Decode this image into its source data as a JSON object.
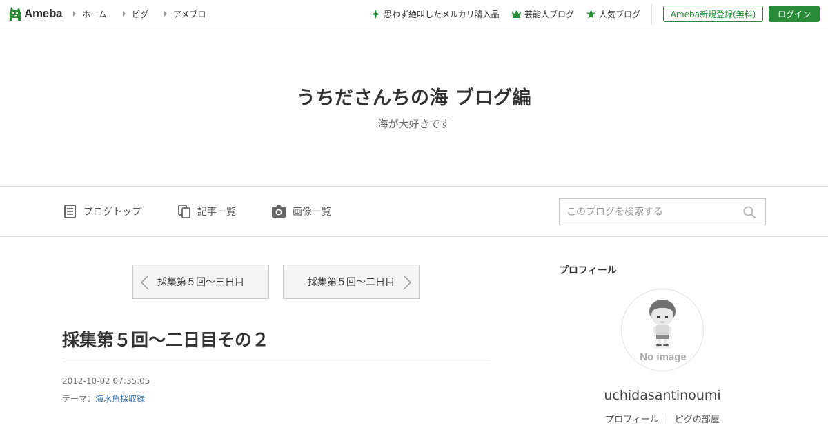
{
  "topbar": {
    "logo_text": "Ameba",
    "nav": [
      "ホーム",
      "ピグ",
      "アメブロ"
    ],
    "right_links": [
      {
        "label": "思わず絶叫したメルカリ購入品",
        "icon": "sparkle-icon"
      },
      {
        "label": "芸能人ブログ",
        "icon": "crown-icon"
      },
      {
        "label": "人気ブログ",
        "icon": "star-icon"
      }
    ],
    "register_label": "Ameba新規登録(無料)",
    "login_label": "ログイン"
  },
  "header": {
    "title": "うちださんちの海 ブログ編",
    "description": "海が大好きです"
  },
  "global_nav": [
    {
      "label": "ブログトップ",
      "icon": "document-icon"
    },
    {
      "label": "記事一覧",
      "icon": "copy-icon"
    },
    {
      "label": "画像一覧",
      "icon": "camera-icon"
    }
  ],
  "search": {
    "placeholder": "このブログを検索する"
  },
  "pager": {
    "prev_label": "採集第５回～三日目",
    "next_label": "採集第５回～二日目"
  },
  "article": {
    "title": "採集第５回～二日目その２",
    "datetime": "2012-10-02 07:35:05",
    "theme_prefix": "テーマ：",
    "theme": "海水魚採取録"
  },
  "sidebar": {
    "heading": "プロフィール",
    "avatar_caption": "No image",
    "username": "uchidasantinoumi",
    "links": [
      "プロフィール",
      "ピグの部屋"
    ]
  },
  "colors": {
    "accent_green": "#2a8c38",
    "link_blue": "#3a6fa6"
  }
}
